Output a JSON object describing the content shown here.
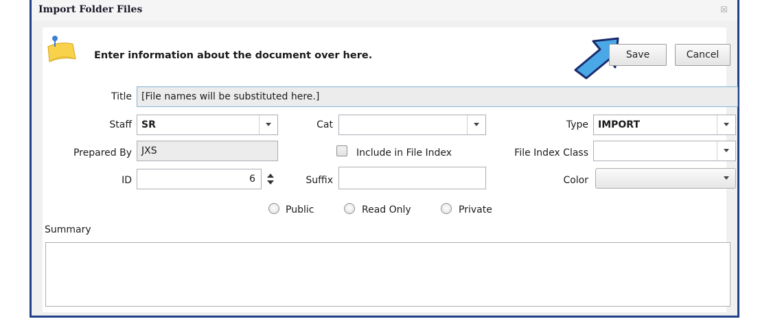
{
  "dialog": {
    "title": "Import Folder Files",
    "close_glyph": "☒",
    "heading": "Enter information about the document over here.",
    "note_icon": "sticky-note-pin-icon",
    "arrow_icon": "pointer-arrow-icon"
  },
  "buttons": {
    "save": "Save",
    "cancel": "Cancel"
  },
  "form": {
    "title_label": "Title",
    "title_value": "[File names will be substituted here.]",
    "staff_label": "Staff",
    "staff_value": "SR",
    "cat_label": "Cat",
    "cat_value": "",
    "type_label": "Type",
    "type_value": "IMPORT",
    "prepared_by_label": "Prepared By",
    "prepared_by_value": "JXS",
    "include_index_label": "Include in File Index",
    "file_index_class_label": "File Index Class",
    "file_index_class_value": "",
    "id_label": "ID",
    "id_value": "6",
    "suffix_label": "Suffix",
    "suffix_value": "",
    "color_label": "Color",
    "color_value": "",
    "radio_public": "Public",
    "radio_read_only": "Read Only",
    "radio_private": "Private",
    "summary_label": "Summary",
    "summary_value": ""
  },
  "colors": {
    "frame": "#1f3f86",
    "arrow_fill": "#4aa8e6",
    "arrow_stroke": "#1a2a6c",
    "note": "#f7d24a"
  }
}
